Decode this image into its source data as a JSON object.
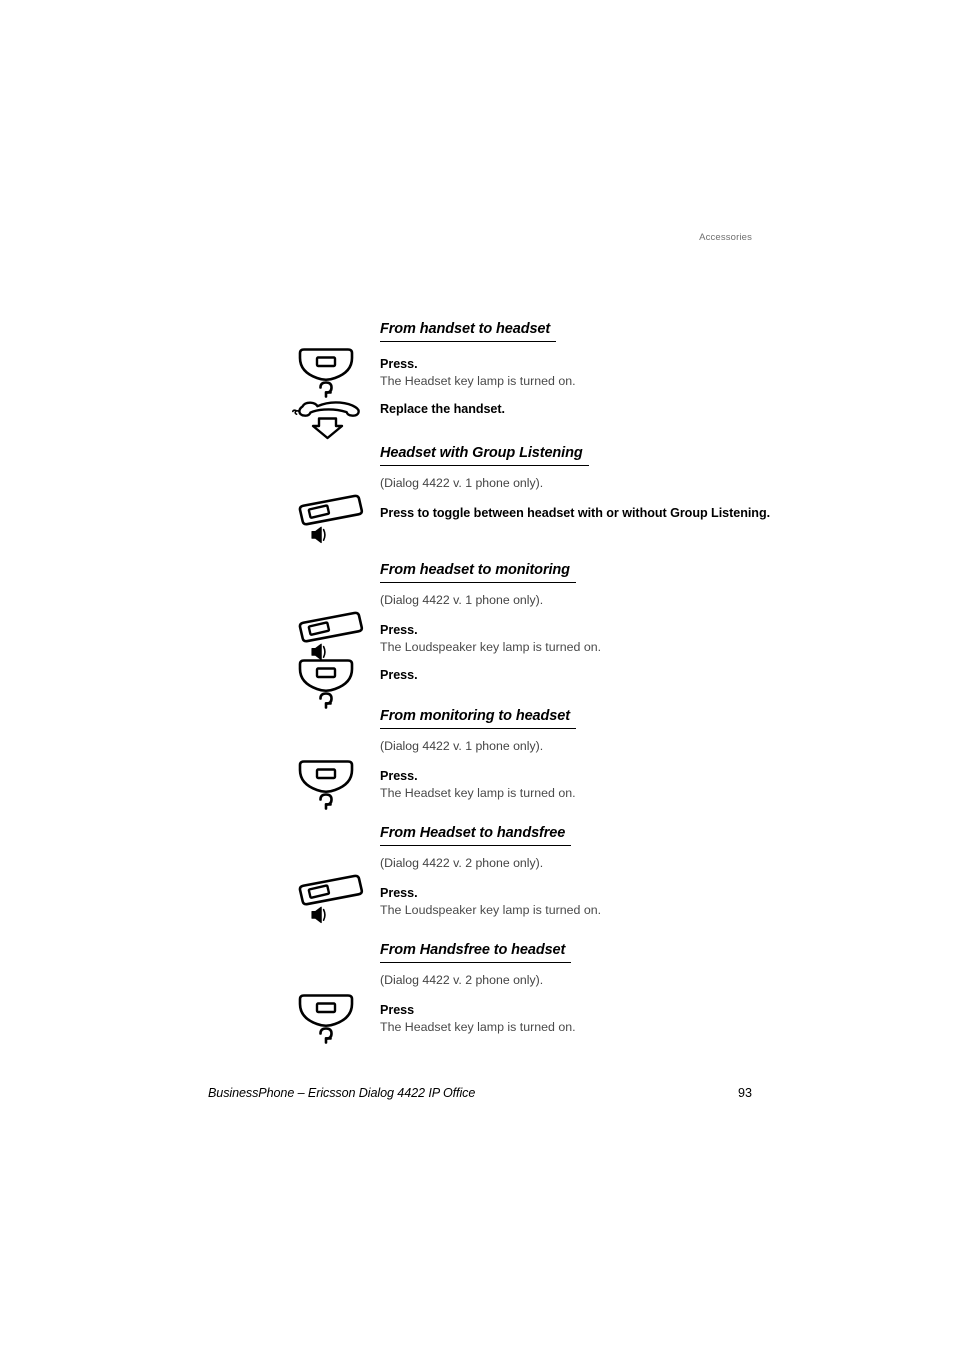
{
  "header": {
    "running_head": "Accessories"
  },
  "sections": [
    {
      "title": "From handset to headset",
      "note": null,
      "steps": [
        {
          "icon": "headset-key-icon",
          "bold": "Press.",
          "sub": "The Headset key lamp is turned on."
        },
        {
          "icon": "replace-handset-icon",
          "bold": "Replace the handset.",
          "sub": null
        }
      ]
    },
    {
      "title": "Headset with Group Listening",
      "note": "(Dialog 4422 v. 1 phone only).",
      "steps": [
        {
          "icon": "loudspeaker-key-icon",
          "bold": "Press to toggle between headset with or without Group Listening.",
          "sub": null
        }
      ]
    },
    {
      "title": "From headset to monitoring",
      "note": "(Dialog 4422 v. 1 phone only).",
      "steps": [
        {
          "icon": "loudspeaker-key-icon",
          "bold": "Press.",
          "sub": "The Loudspeaker key lamp is turned on."
        },
        {
          "icon": "headset-key-icon",
          "bold": "Press.",
          "sub": null
        }
      ]
    },
    {
      "title": "From monitoring to headset",
      "note": "(Dialog 4422 v. 1 phone only).",
      "steps": [
        {
          "icon": "headset-key-icon",
          "bold": "Press.",
          "sub": "The Headset key lamp is turned on."
        }
      ]
    },
    {
      "title": "From Headset to handsfree",
      "note": "(Dialog 4422 v. 2 phone only).",
      "steps": [
        {
          "icon": "loudspeaker-key-icon",
          "bold": "Press.",
          "sub": "The Loudspeaker key lamp is turned on."
        }
      ]
    },
    {
      "title": "From Handsfree to headset",
      "note": "(Dialog 4422 v. 2 phone only).",
      "steps": [
        {
          "icon": "headset-key-icon",
          "bold": "Press",
          "sub": "The Headset key lamp is turned on."
        }
      ]
    }
  ],
  "footer": {
    "left": "BusinessPhone – Ericsson Dialog 4422 IP Office",
    "page_number": "93"
  },
  "colors": {
    "text": "#000000",
    "muted": "#4a4a4a",
    "header_gray": "#6f6f6f",
    "background": "#ffffff"
  }
}
